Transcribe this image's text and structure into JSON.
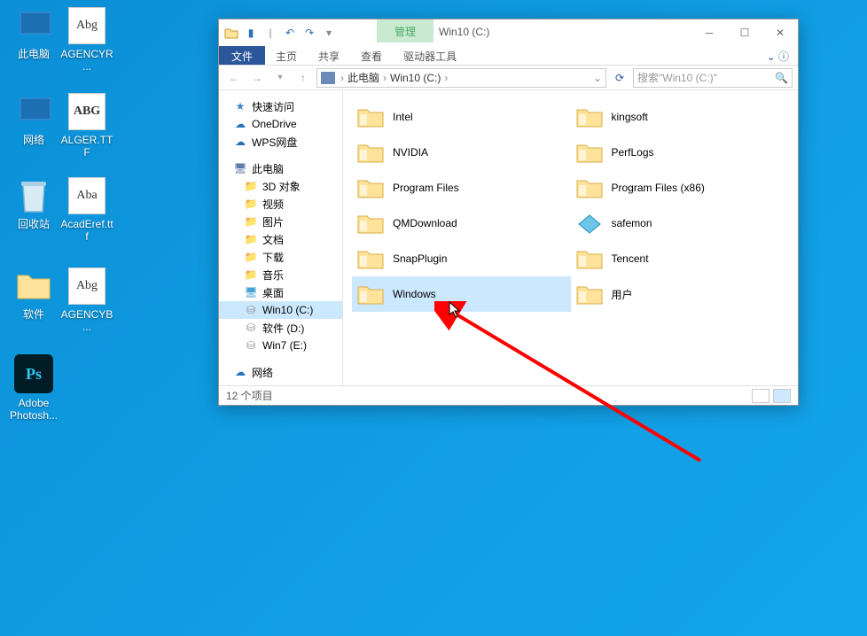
{
  "desktop_icons": [
    {
      "label": "此电脑",
      "type": "pc"
    },
    {
      "label": "AGENCYR...",
      "type": "font",
      "glyph": "Abg"
    },
    {
      "label": "网络",
      "type": "pc"
    },
    {
      "label": "ALGER.TTF",
      "type": "font",
      "glyph": "ABG"
    },
    {
      "label": "回收站",
      "type": "trash"
    },
    {
      "label": "AcadEref.ttf",
      "type": "font",
      "glyph": "Aba"
    },
    {
      "label": "软件",
      "type": "folder"
    },
    {
      "label": "AGENCYB...",
      "type": "font",
      "glyph": "Abg"
    },
    {
      "label": "Adobe Photosh...",
      "type": "ps",
      "glyph": "Ps"
    }
  ],
  "explorer": {
    "title": "Win10 (C:)",
    "manage_tab": "管理",
    "ribbon": {
      "file": "文件",
      "tabs": [
        "主页",
        "共享",
        "查看",
        "驱动器工具"
      ]
    },
    "breadcrumb": [
      "此电脑",
      "Win10 (C:)"
    ],
    "search_placeholder": "搜索\"Win10 (C:)\"",
    "sidebar": [
      {
        "label": "快速访问",
        "icon": "star"
      },
      {
        "label": "OneDrive",
        "icon": "cloud"
      },
      {
        "label": "WPS网盘",
        "icon": "cloud"
      },
      {
        "label": "此电脑",
        "icon": "pc",
        "spacer_before": true
      },
      {
        "label": "3D 对象",
        "icon": "folder",
        "level": 2
      },
      {
        "label": "视频",
        "icon": "folder",
        "level": 2
      },
      {
        "label": "图片",
        "icon": "folder",
        "level": 2
      },
      {
        "label": "文档",
        "icon": "folder",
        "level": 2
      },
      {
        "label": "下载",
        "icon": "folder",
        "level": 2
      },
      {
        "label": "音乐",
        "icon": "folder",
        "level": 2
      },
      {
        "label": "桌面",
        "icon": "desk",
        "level": 2
      },
      {
        "label": "Win10 (C:)",
        "icon": "disk",
        "level": 2,
        "active": true
      },
      {
        "label": "软件 (D:)",
        "icon": "disk",
        "level": 2
      },
      {
        "label": "Win7 (E:)",
        "icon": "disk",
        "level": 2
      },
      {
        "label": "网络",
        "icon": "cloud",
        "spacer_before": true
      }
    ],
    "folders": [
      {
        "name": "Intel"
      },
      {
        "name": "kingsoft"
      },
      {
        "name": "NVIDIA"
      },
      {
        "name": "PerfLogs"
      },
      {
        "name": "Program Files"
      },
      {
        "name": "Program Files (x86)"
      },
      {
        "name": "QMDownload"
      },
      {
        "name": "safemon",
        "special": true
      },
      {
        "name": "SnapPlugin"
      },
      {
        "name": "Tencent"
      },
      {
        "name": "Windows",
        "selected": true
      },
      {
        "name": "用户"
      }
    ],
    "status": "12 个项目"
  }
}
